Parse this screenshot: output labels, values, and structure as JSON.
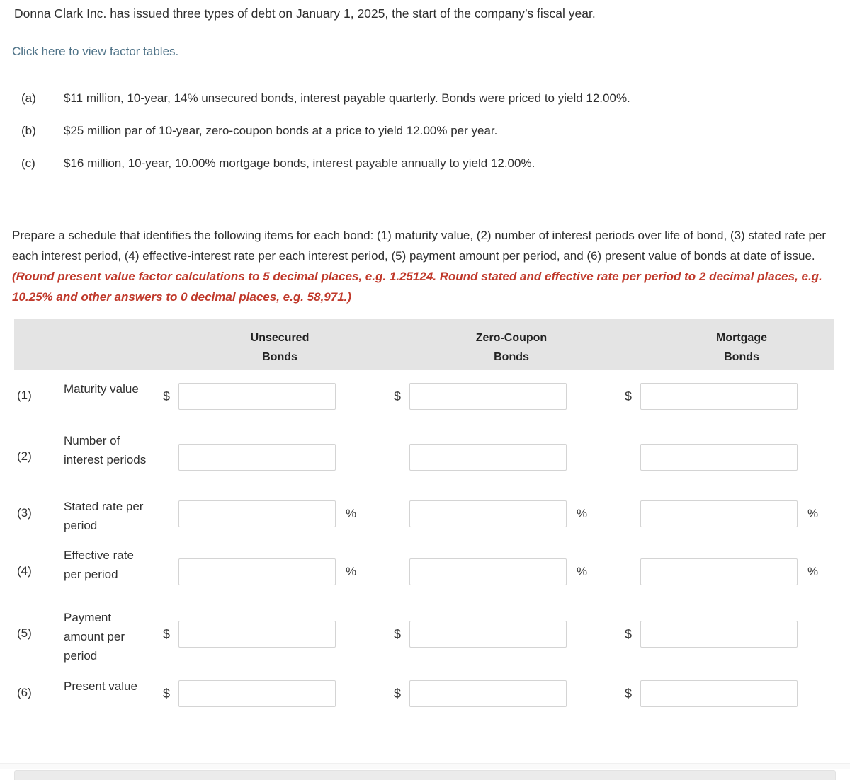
{
  "intro": {
    "statement": "Donna Clark Inc. has issued three types of debt on January 1, 2025, the start of the company’s fiscal year.",
    "factor_link": "Click here to view factor tables."
  },
  "debt_items": [
    {
      "letter": "(a)",
      "text": "$11 million, 10-year, 14% unsecured bonds, interest payable quarterly. Bonds were priced to yield 12.00%."
    },
    {
      "letter": "(b)",
      "text": "$25 million par of 10-year, zero-coupon bonds at a price to yield 12.00% per year."
    },
    {
      "letter": "(c)",
      "text": "$16 million, 10-year, 10.00% mortgage bonds, interest payable annually to yield 12.00%."
    }
  ],
  "instructions": {
    "main": "Prepare a schedule that identifies the following items for each bond: (1) maturity value, (2) number of interest periods over life of bond, (3) stated rate per each interest period, (4) effective-interest rate per each interest period, (5) payment amount per period, and (6) present value of bonds at date of issue. ",
    "emphasis": "(Round present value factor calculations to 5 decimal places, e.g. 1.25124. Round stated and effective rate per period to 2 decimal places, e.g. 10.25% and other answers to 0 decimal places, e.g. 58,971.)",
    "emphasis_color": "#c0392b"
  },
  "table": {
    "header_background": "#e4e4e4",
    "columns": [
      {
        "line1": "Unsecured",
        "line2": "Bonds"
      },
      {
        "line1": "Zero-Coupon",
        "line2": "Bonds"
      },
      {
        "line1": "Mortgage",
        "line2": "Bonds"
      }
    ],
    "rows": [
      {
        "number": "(1)",
        "label": "Maturity value",
        "prefix": "$",
        "suffix": "",
        "values": [
          "",
          "",
          ""
        ]
      },
      {
        "number": "(2)",
        "label": "Number of interest periods",
        "prefix": "",
        "suffix": "",
        "values": [
          "",
          "",
          ""
        ]
      },
      {
        "number": "(3)",
        "label": "Stated rate per period",
        "prefix": "",
        "suffix": "%",
        "values": [
          "",
          "",
          ""
        ]
      },
      {
        "number": "(4)",
        "label": "Effective rate per period",
        "prefix": "",
        "suffix": "%",
        "values": [
          "",
          "",
          ""
        ]
      },
      {
        "number": "(5)",
        "label": "Payment amount per period",
        "prefix": "$",
        "suffix": "",
        "values": [
          "",
          "",
          ""
        ]
      },
      {
        "number": "(6)",
        "label": "Present value",
        "prefix": "$",
        "suffix": "",
        "values": [
          "",
          "",
          ""
        ]
      }
    ]
  }
}
